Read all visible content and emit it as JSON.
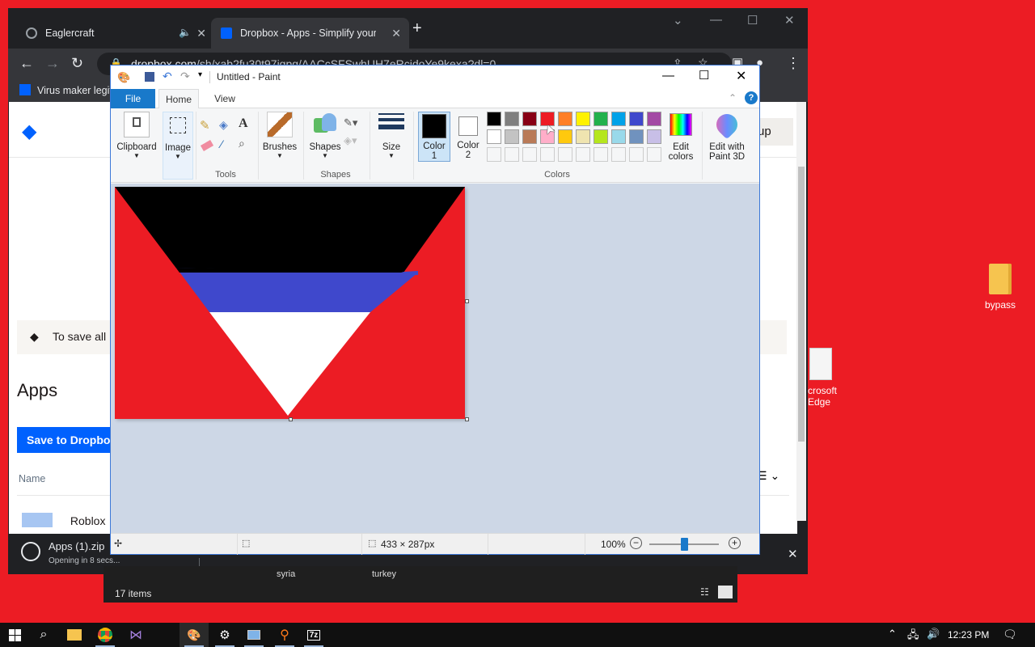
{
  "desktop": {
    "icons": [
      {
        "label": "bypass"
      },
      {
        "label": "crosoft\nEdge"
      }
    ]
  },
  "chrome": {
    "tabs": [
      {
        "title": "Eaglercraft",
        "audio_icon": "speaker-icon"
      },
      {
        "title": "Dropbox - Apps - Simplify your li"
      }
    ],
    "url_host": "dropbox.com",
    "url_path": "/sh/xab2fu30t97iqpg/AACcSFSwhUH7eRcjdoYe9kexa?dl=0",
    "bookmark": "Virus maker legit",
    "page": {
      "save_banner": "To save all",
      "heading": "Apps",
      "save_button": "Save to Dropbox",
      "column_name": "Name",
      "first_item": "Roblox",
      "signup_partial": "up"
    },
    "download": {
      "filename": "Apps (1).zip",
      "status": "Opening in 8 secs..."
    }
  },
  "explorer": {
    "items_count": "17 items",
    "cols": [
      "syria",
      "turkey"
    ]
  },
  "paint": {
    "title": "Untitled - Paint",
    "tabs": [
      "File",
      "Home",
      "View"
    ],
    "groups": {
      "clipboard": "Clipboard",
      "image": "Image",
      "tools": "Tools",
      "brushes": "Brushes",
      "shapes": "Shapes",
      "shapes_group": "Shapes",
      "size": "Size",
      "color1": "Color\n1",
      "color2": "Color\n2",
      "colors": "Colors",
      "edit_colors": "Edit\ncolors",
      "edit_paint3d": "Edit with\nPaint 3D"
    },
    "palette_row1": [
      "#000000",
      "#7f7f7f",
      "#880015",
      "#ed1c24",
      "#ff7f27",
      "#fff200",
      "#22b14c",
      "#00a2e8",
      "#3f48cc",
      "#a349a4"
    ],
    "palette_row2": [
      "#ffffff",
      "#c3c3c3",
      "#b97a57",
      "#ffaec9",
      "#ffc90e",
      "#efe4b0",
      "#b5e61d",
      "#99d9ea",
      "#7092be",
      "#c8bfe7"
    ],
    "color1_value": "#000000",
    "color2_value": "#ffffff",
    "image_size": "433 × 287px",
    "zoom": "100%",
    "zoom_level_fraction": 0.5
  },
  "taskbar": {
    "time": "12:23 PM"
  }
}
